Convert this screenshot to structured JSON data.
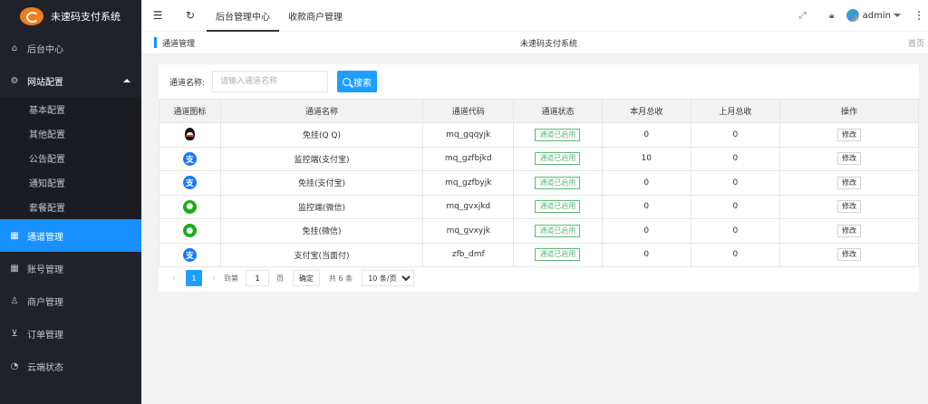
{
  "app": {
    "title": "未速码支付系统"
  },
  "sidebar": {
    "items": [
      {
        "label": "后台中心",
        "icon": "home-icon"
      },
      {
        "label": "网站配置",
        "icon": "gear-icon",
        "open": true
      },
      {
        "label": "通道管理",
        "icon": "channel-icon",
        "active": true
      },
      {
        "label": "账号管理",
        "icon": "account-icon"
      },
      {
        "label": "商户管理",
        "icon": "user-icon"
      },
      {
        "label": "订单管理",
        "icon": "cart-icon"
      },
      {
        "label": "云端状态",
        "icon": "dashboard-icon"
      }
    ],
    "submenu": [
      "基本配置",
      "其他配置",
      "公告配置",
      "通知配置",
      "套餐配置"
    ]
  },
  "topbar": {
    "tabs": [
      "后台管理中心",
      "收款商户管理"
    ],
    "user": "admin"
  },
  "breadcrumb": {
    "left": "通道管理",
    "center": "未速码支付系统",
    "right": "首页"
  },
  "search": {
    "label": "通道名称:",
    "placeholder": "请输入通道名称",
    "button": "搜索"
  },
  "table": {
    "headers": [
      "通道图标",
      "通道名称",
      "通道代码",
      "通道状态",
      "本月总收",
      "上月总收",
      "操作"
    ],
    "rows": [
      {
        "icon": "qq-icon",
        "name": "免挂(Q Q)",
        "code": "mq_gqqyjk",
        "status": "通道已启用",
        "month": "0",
        "last": "0",
        "op": "修改"
      },
      {
        "icon": "alipay-icon",
        "name": "监控端(支付宝)",
        "code": "mq_gzfbjkd",
        "status": "通道已启用",
        "month": "10",
        "last": "0",
        "op": "修改"
      },
      {
        "icon": "alipay-icon",
        "name": "免挂(支付宝)",
        "code": "mq_gzfbyjk",
        "status": "通道已启用",
        "month": "0",
        "last": "0",
        "op": "修改"
      },
      {
        "icon": "wechat-icon",
        "name": "监控端(微信)",
        "code": "mq_gvxjkd",
        "status": "通道已启用",
        "month": "0",
        "last": "0",
        "op": "修改"
      },
      {
        "icon": "wechat-icon",
        "name": "免挂(微信)",
        "code": "mq_gvxyjk",
        "status": "通道已启用",
        "month": "0",
        "last": "0",
        "op": "修改"
      },
      {
        "icon": "alipay-icon",
        "name": "支付宝(当面付)",
        "code": "zfb_dmf",
        "status": "通道已启用",
        "month": "0",
        "last": "0",
        "op": "修改"
      }
    ]
  },
  "pager": {
    "current": "1",
    "goto_prefix": "到第",
    "goto_value": "1",
    "goto_suffix": "页",
    "confirm": "确定",
    "total": "共 6 条",
    "page_size": "10 条/页"
  },
  "colors": {
    "accent": "#1890ff",
    "sidebar_bg": "#20222a",
    "status_green": "#5fb878"
  }
}
